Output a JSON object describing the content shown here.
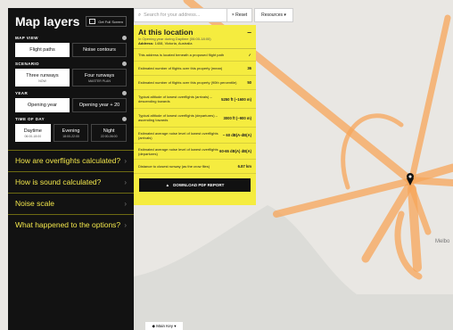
{
  "sidebar": {
    "title": "Map layers",
    "fullscreen_label": "Get Full Screen",
    "map_view": {
      "label": "MAP VIEW",
      "options": [
        "Flight paths",
        "Noise contours"
      ],
      "selected": 0
    },
    "scenario": {
      "label": "SCENARIO",
      "options": [
        {
          "name": "Three runways",
          "sub": "NOW"
        },
        {
          "name": "Four runways",
          "sub": "MASTER PLAN"
        }
      ],
      "selected": 0
    },
    "year": {
      "label": "YEAR",
      "options": [
        "Opening year",
        "Opening year + 20"
      ],
      "selected": 0
    },
    "time_of_day": {
      "label": "TIME OF DAY",
      "options": [
        {
          "name": "Daytime",
          "sub": "06:00-18:00"
        },
        {
          "name": "Evening",
          "sub": "18:00-22:00"
        },
        {
          "name": "Night",
          "sub": "22:00-06:00"
        }
      ],
      "selected": 0
    },
    "accordion": [
      "How are overflights calculated?",
      "How is sound calculated?",
      "Noise scale",
      "What happened to the options?"
    ]
  },
  "topbar": {
    "search_placeholder": "Search for your address...",
    "reset_label": "Reset",
    "resources_label": "Resources"
  },
  "panel": {
    "title": "At this location",
    "subtitle": "In Opening year during Daytime (06:00-18:00)",
    "address_label": "Address:",
    "address": "1408, Victoria, Australia",
    "rows": [
      {
        "label": "This address is located beneath a proposed flight path",
        "value": "✓"
      },
      {
        "label": "Estimated number of flights over this property (mean)",
        "value": "36"
      },
      {
        "label": "Estimated number of flights over this property (90th percentile)",
        "value": "50"
      },
      {
        "label": "Typical altitude of lowest overflights (arrivals) – descending towards",
        "value": "5250 ft (~1600 m)"
      },
      {
        "label": "Typical altitude of lowest overflights (departures) – ascending towards",
        "value": "3000 ft (~900 m)"
      },
      {
        "label": "Estimated average noise level of lowest overflights (arrivals)",
        "value": "~ 60 dB(A-dB(A)"
      },
      {
        "label": "Estimated average noise level of lowest overflights (departures)",
        "value": "60-65 dB(A) dB(A)"
      },
      {
        "label": "Distance to closest runway (as the crow flies)",
        "value": "6.87 km"
      }
    ],
    "pdf_label": "DOWNLOAD PDF REPORT"
  },
  "map": {
    "city_label": "Melbo",
    "main_key_label": "Main Key"
  },
  "colors": {
    "panel_bg": "#f5ec3f",
    "sidebar_bg": "#121212",
    "accent_yellow": "#f1e54b",
    "flight_path": "#f7a55a"
  }
}
